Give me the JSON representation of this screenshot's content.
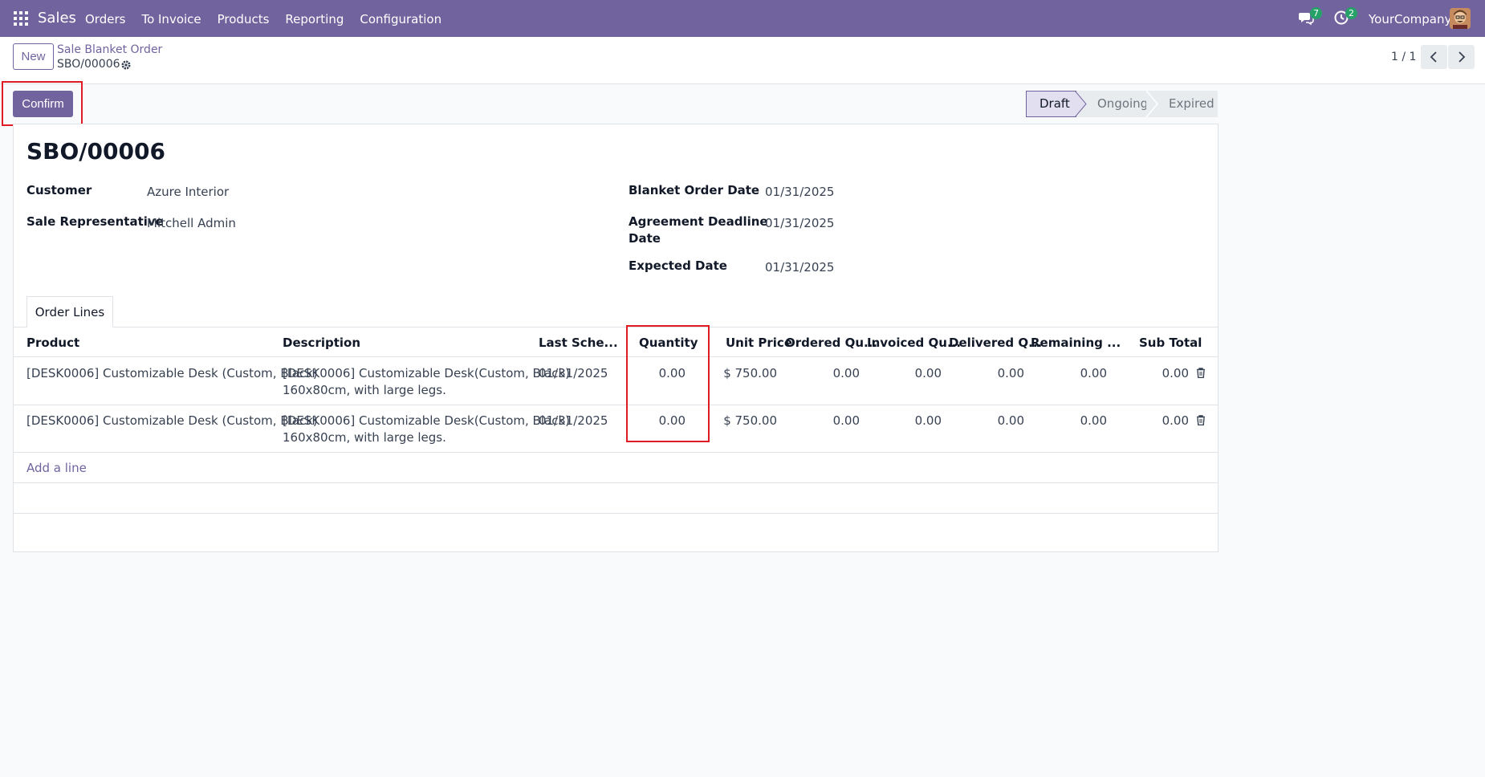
{
  "navbar": {
    "app_name": "Sales",
    "menu": [
      "Orders",
      "To Invoice",
      "Products",
      "Reporting",
      "Configuration"
    ],
    "chat_count": "7",
    "activity_count": "2",
    "company": "YourCompany"
  },
  "control": {
    "new_label": "New",
    "breadcrumb_parent": "Sale Blanket Order",
    "breadcrumb_current": "SBO/00006",
    "pager": "1 / 1"
  },
  "actions": {
    "confirm_label": "Confirm"
  },
  "status": {
    "stages": [
      "Draft",
      "Ongoing",
      "Expired"
    ],
    "active": "Draft"
  },
  "form": {
    "title": "SBO/00006",
    "customer_label": "Customer",
    "customer": "Azure Interior",
    "rep_label": "Sale Representative",
    "rep": "Mitchell Admin",
    "order_date_label": "Blanket Order Date",
    "order_date": "01/31/2025",
    "deadline_label_1": "Agreement Deadline",
    "deadline_label_2": "Date",
    "deadline": "01/31/2025",
    "expected_label": "Expected Date",
    "expected": "01/31/2025"
  },
  "tabs": {
    "order_lines": "Order Lines"
  },
  "table": {
    "headers": [
      "Product",
      "Description",
      "Last Sche...",
      "Quantity",
      "Unit Price",
      "Ordered Qu...",
      "Invoiced Qu...",
      "Delivered Q...",
      "Remaining ...",
      "Sub Total"
    ],
    "rows": [
      {
        "product": "[DESK0006] Customizable Desk (Custom, Black)",
        "desc1": "[DESK0006] Customizable Desk(Custom, Black)",
        "desc2": "160x80cm, with large legs.",
        "date": "01/31/2025",
        "quantity": "0.00",
        "unit_price": "$ 750.00",
        "ordered": "0.00",
        "invoiced": "0.00",
        "delivered": "0.00",
        "remaining": "0.00",
        "subtotal": "0.00"
      },
      {
        "product": "[DESK0006] Customizable Desk (Custom, Black)",
        "desc1": "[DESK0006] Customizable Desk(Custom, Black)",
        "desc2": "160x80cm, with large legs.",
        "date": "01/31/2025",
        "quantity": "0.00",
        "unit_price": "$ 750.00",
        "ordered": "0.00",
        "invoiced": "0.00",
        "delivered": "0.00",
        "remaining": "0.00",
        "subtotal": "0.00"
      }
    ],
    "add_line": "Add a line"
  },
  "colors": {
    "brand": "#71639e",
    "highlight": "#e01b24",
    "badge": "#26a269"
  }
}
